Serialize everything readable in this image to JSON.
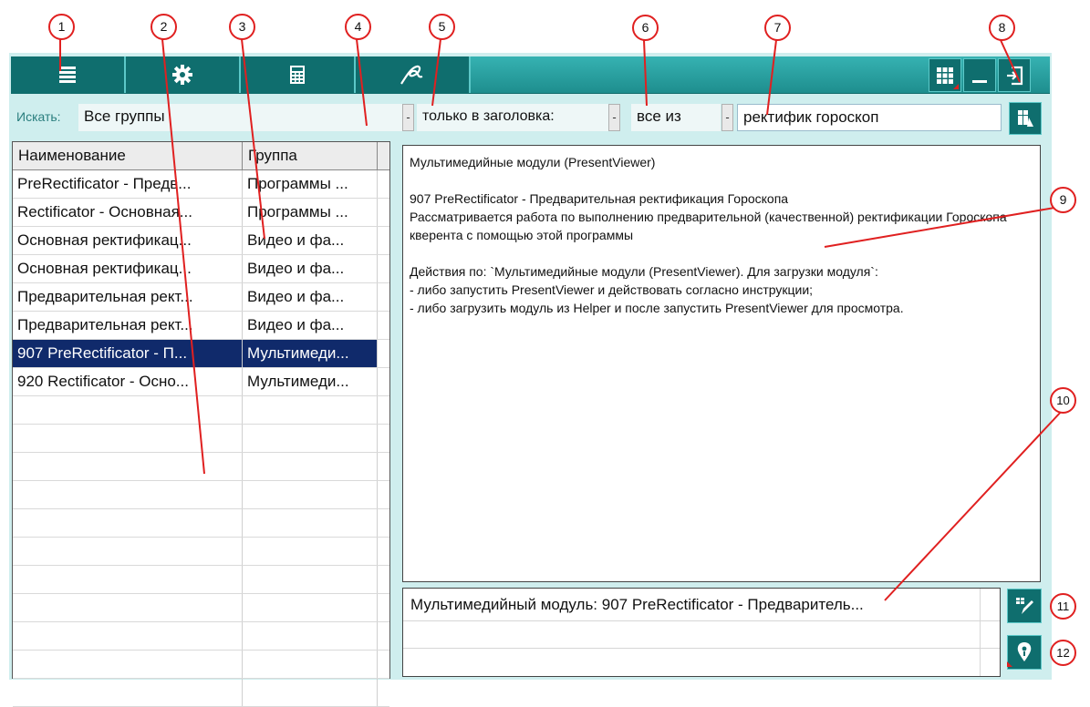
{
  "callouts": [
    "1",
    "2",
    "3",
    "4",
    "5",
    "6",
    "7",
    "8",
    "9",
    "10",
    "11",
    "12"
  ],
  "toolbar": {
    "buttons": [
      {
        "icon": "list-menu-icon"
      },
      {
        "icon": "gear-icon"
      },
      {
        "icon": "calculator-icon"
      },
      {
        "icon": "signature-icon"
      }
    ],
    "right_buttons": [
      {
        "icon": "grid-icon"
      },
      {
        "icon": "minimize-icon"
      },
      {
        "icon": "exit-icon"
      }
    ],
    "accent_color": "#1e9e9e"
  },
  "search": {
    "label": "Искать:",
    "group_value": "Все группы",
    "scope_value": "только в заголовка:",
    "mode_value": "все из",
    "query_value": "ректифик гороскоп",
    "search_icon": "binoculars-icon"
  },
  "table": {
    "columns": [
      "Наименование",
      "Группа"
    ],
    "rows": [
      {
        "name": "PreRectificator - Предв...",
        "group": "Программы ..."
      },
      {
        "name": "Rectificator - Основная...",
        "group": "Программы ..."
      },
      {
        "name": "Основная ректификац...",
        "group": "Видео и фа..."
      },
      {
        "name": "Основная ректификац...",
        "group": "Видео и фа..."
      },
      {
        "name": "Предварительная рект...",
        "group": "Видео и фа..."
      },
      {
        "name": "Предварительная рект...",
        "group": "Видео и фа..."
      },
      {
        "name": "907 PreRectificator - П...",
        "group": "Мультимеди...",
        "selected": true
      },
      {
        "name": "920 Rectificator - Осно...",
        "group": "Мультимеди..."
      }
    ],
    "empty_rows": 11,
    "selection_color": "#102a6b"
  },
  "description": {
    "heading": "Мультимедийные модули (PresentViewer)",
    "title": "907 PreRectificator - Предварительная ректификация Гороскопа",
    "body": "Рассматривается работа по выполнению предварительной (качественной) ректификации Гороскопа кверента с помощью этой программы",
    "actions_intro": "Действия по: `Мультимедийные модули (PresentViewer). Для загрузки модуля`:",
    "action_1": "- либо запустить PresentViewer и действовать согласно инструкции;",
    "action_2": "- либо загрузить модуль из Helper и после запустить PresentViewer для просмотра."
  },
  "modules": {
    "item": "Мультимедийный модуль: 907 PreRectificator - Предваритель...",
    "edit_icon": "edit-pencil-icon",
    "locate_icon": "map-pin-icon"
  }
}
